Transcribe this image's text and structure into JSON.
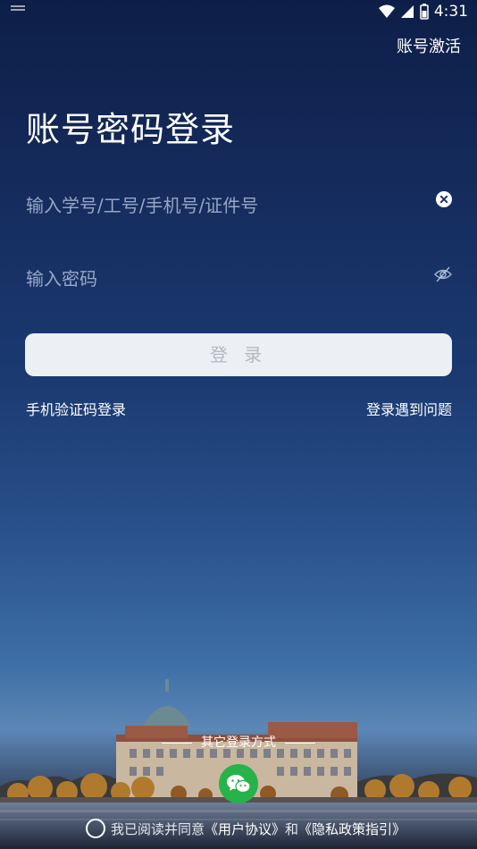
{
  "status_bar": {
    "time": "4:31"
  },
  "header": {
    "activate_link": "账号激活"
  },
  "title": "账号密码登录",
  "form": {
    "username_placeholder": "输入学号/工号/手机号/证件号",
    "password_placeholder": "输入密码",
    "login_button": "登 录"
  },
  "links": {
    "sms_login": "手机验证码登录",
    "help": "登录遇到问题"
  },
  "other_login": {
    "title": "其它登录方式",
    "wechat_icon": "wechat-icon"
  },
  "agreement": {
    "prefix": "我已阅读并同意",
    "user_agreement": "《用户协议》",
    "and": "和",
    "privacy_policy": "《隐私政策指引》"
  },
  "colors": {
    "wechat_green": "#27b24a",
    "button_bg": "#eceff4",
    "bg_top": "#0d1f48"
  }
}
